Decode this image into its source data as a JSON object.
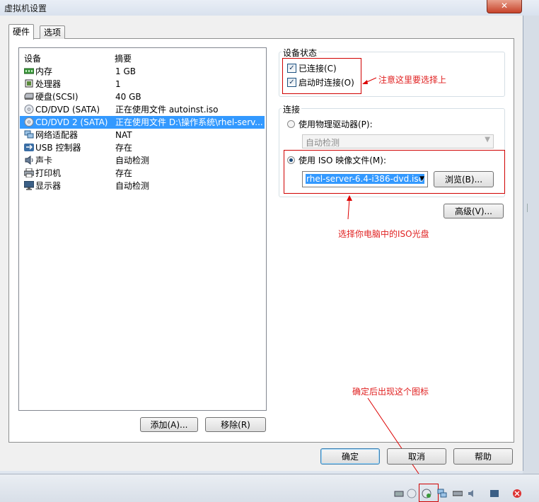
{
  "window": {
    "title": "虚拟机设置",
    "close_glyph": "✕"
  },
  "tabs": [
    {
      "label": "硬件"
    },
    {
      "label": "选项"
    }
  ],
  "device_list": {
    "headers": {
      "device": "设备",
      "summary": "摘要"
    },
    "rows": [
      {
        "name": "内存",
        "summary": "1 GB",
        "icon": "memory-icon"
      },
      {
        "name": "处理器",
        "summary": "1",
        "icon": "processor-icon"
      },
      {
        "name": "硬盘(SCSI)",
        "summary": "40 GB",
        "icon": "hard-disk-icon"
      },
      {
        "name": "CD/DVD (SATA)",
        "summary": "正在使用文件 autoinst.iso",
        "icon": "cd-dvd-icon"
      },
      {
        "name": "CD/DVD 2 (SATA)",
        "summary": "正在使用文件 D:\\操作系统\\rhel-serv...",
        "icon": "cd-dvd-icon",
        "selected": true
      },
      {
        "name": "网络适配器",
        "summary": "NAT",
        "icon": "network-adapter-icon"
      },
      {
        "name": "USB 控制器",
        "summary": "存在",
        "icon": "usb-icon"
      },
      {
        "name": "声卡",
        "summary": "自动检测",
        "icon": "sound-card-icon"
      },
      {
        "name": "打印机",
        "summary": "存在",
        "icon": "printer-icon"
      },
      {
        "name": "显示器",
        "summary": "自动检测",
        "icon": "display-icon"
      }
    ],
    "add_button": "添加(A)...",
    "remove_button": "移除(R)"
  },
  "device_status": {
    "title": "设备状态",
    "connected": {
      "label": "已连接(C)",
      "checked": true
    },
    "connect_at_power_on": {
      "label": "启动时连接(O)",
      "checked": true
    }
  },
  "connection": {
    "title": "连接",
    "physical": {
      "label": "使用物理驱动器(P):",
      "selected": false,
      "value": "自动检测"
    },
    "iso": {
      "label": "使用 ISO 映像文件(M):",
      "selected": true,
      "value": "rhel-server-6.4-i386-dvd.iso"
    },
    "browse_button": "浏览(B)...",
    "advanced_button": "高级(V)..."
  },
  "annotations": {
    "note1": "注意这里要选择上",
    "note2": "选择你电脑中的ISO光盘",
    "note3": "确定后出现这个图标"
  },
  "footer": {
    "ok": "确定",
    "cancel": "取消",
    "help": "帮助"
  },
  "colors": {
    "selection": "#3399ff",
    "annotation": "#e02020"
  }
}
